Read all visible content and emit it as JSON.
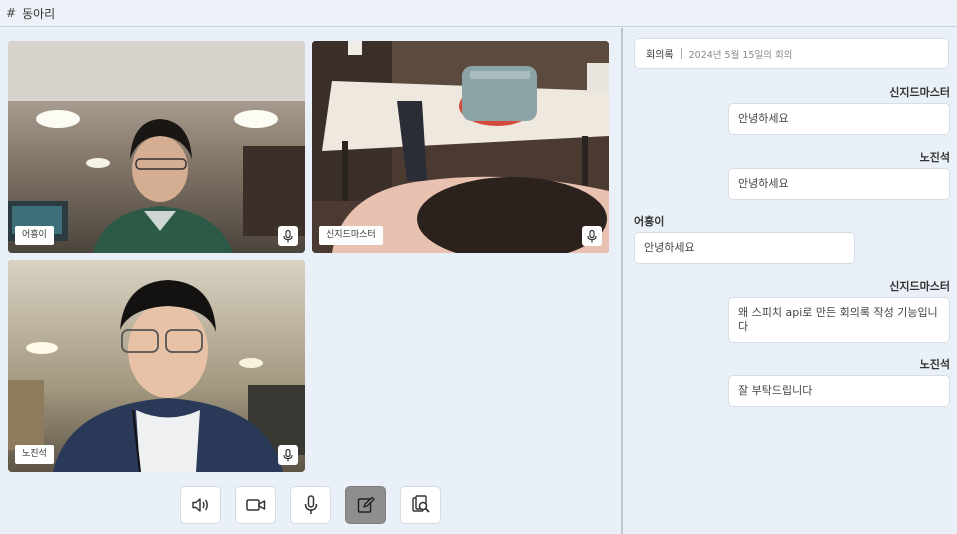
{
  "channel": {
    "icon": "hash-icon",
    "symbol": "#",
    "name": "동아리"
  },
  "participants": [
    {
      "name": "어흥이",
      "mic_icon": "mic-icon"
    },
    {
      "name": "신지드마스터",
      "mic_icon": "mic-icon"
    },
    {
      "name": "노진석",
      "mic_icon": "mic-icon"
    }
  ],
  "controls": [
    {
      "name": "speaker-button",
      "icon": "speaker-icon",
      "active": false
    },
    {
      "name": "camera-button",
      "icon": "video-camera-icon",
      "active": false
    },
    {
      "name": "microphone-button",
      "icon": "mic-icon",
      "active": false
    },
    {
      "name": "minutes-edit-button",
      "icon": "edit-icon",
      "active": true
    },
    {
      "name": "minutes-search-button",
      "icon": "document-search-icon",
      "active": false
    }
  ],
  "minutes": {
    "label": "회의록",
    "date": "2024년 5월 15일의 회의"
  },
  "messages": [
    {
      "sender": "신지드마스터",
      "text": "안녕하세요",
      "side": "right"
    },
    {
      "sender": "노진석",
      "text": "안녕하세요",
      "side": "right"
    },
    {
      "sender": "어흥이",
      "text": "안녕하세요",
      "side": "left"
    },
    {
      "sender": "신지드마스터",
      "text": "왜 스피치 api로 만든 회의록 작성 기능입니다",
      "side": "right"
    },
    {
      "sender": "노진석",
      "text": "잘 부탁드립니다",
      "side": "right"
    }
  ],
  "colors": {
    "background": "#eaf0f7",
    "active_control": "#8e8e8e",
    "panel_border": "#bcc4cd"
  }
}
